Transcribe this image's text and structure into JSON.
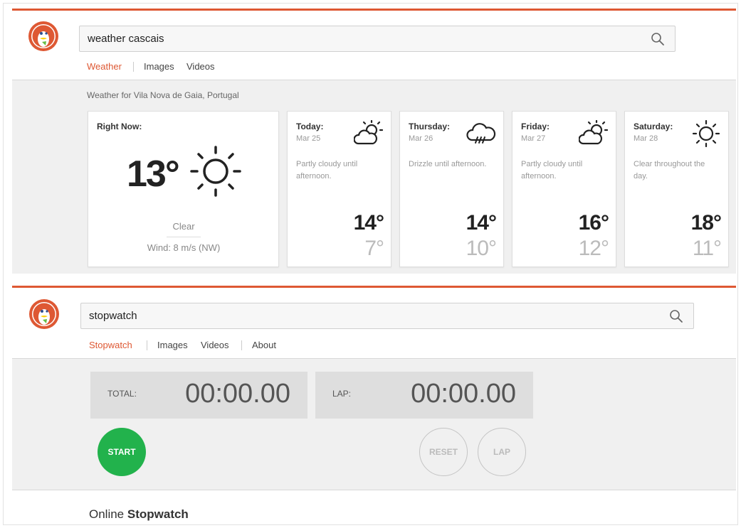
{
  "weather_panel": {
    "search": {
      "value": "weather cascais"
    },
    "tabs": [
      {
        "label": "Weather",
        "active": true
      },
      {
        "label": "Images"
      },
      {
        "label": "Videos"
      }
    ],
    "location": "Weather for Vila Nova de Gaia, Portugal",
    "now": {
      "title": "Right Now:",
      "temp": "13°",
      "icon": "sun-icon",
      "condition": "Clear",
      "wind": "Wind: 8 m/s (NW)"
    },
    "days": [
      {
        "name": "Today:",
        "date": "Mar 25",
        "icon": "partly-cloudy-icon",
        "desc": "Partly cloudy until afternoon.",
        "hi": "14°",
        "lo": "7°"
      },
      {
        "name": "Thursday:",
        "date": "Mar 26",
        "icon": "drizzle-icon",
        "desc": "Drizzle until afternoon.",
        "hi": "14°",
        "lo": "10°"
      },
      {
        "name": "Friday:",
        "date": "Mar 27",
        "icon": "partly-cloudy-icon",
        "desc": "Partly cloudy until afternoon.",
        "hi": "16°",
        "lo": "12°"
      },
      {
        "name": "Saturday:",
        "date": "Mar 28",
        "icon": "sun-icon",
        "desc": "Clear throughout the day.",
        "hi": "18°",
        "lo": "11°"
      }
    ]
  },
  "stopwatch_panel": {
    "search": {
      "value": "stopwatch"
    },
    "tabs": [
      {
        "label": "Stopwatch",
        "active": true
      },
      {
        "label": "Images"
      },
      {
        "label": "Videos"
      },
      {
        "label": "About"
      }
    ],
    "total_label": "TOTAL:",
    "total_value": "00:00.00",
    "lap_label": "LAP:",
    "lap_value": "00:00.00",
    "start_label": "START",
    "reset_label": "RESET",
    "lap_button_label": "LAP",
    "footer_prefix": "Online",
    "footer_bold": "Stopwatch"
  },
  "colors": {
    "accent": "#de5833",
    "start_green": "#22b24c"
  },
  "icons": [
    "duckduckgo-logo-icon",
    "search-icon",
    "sun-icon",
    "partly-cloudy-icon",
    "drizzle-icon"
  ]
}
